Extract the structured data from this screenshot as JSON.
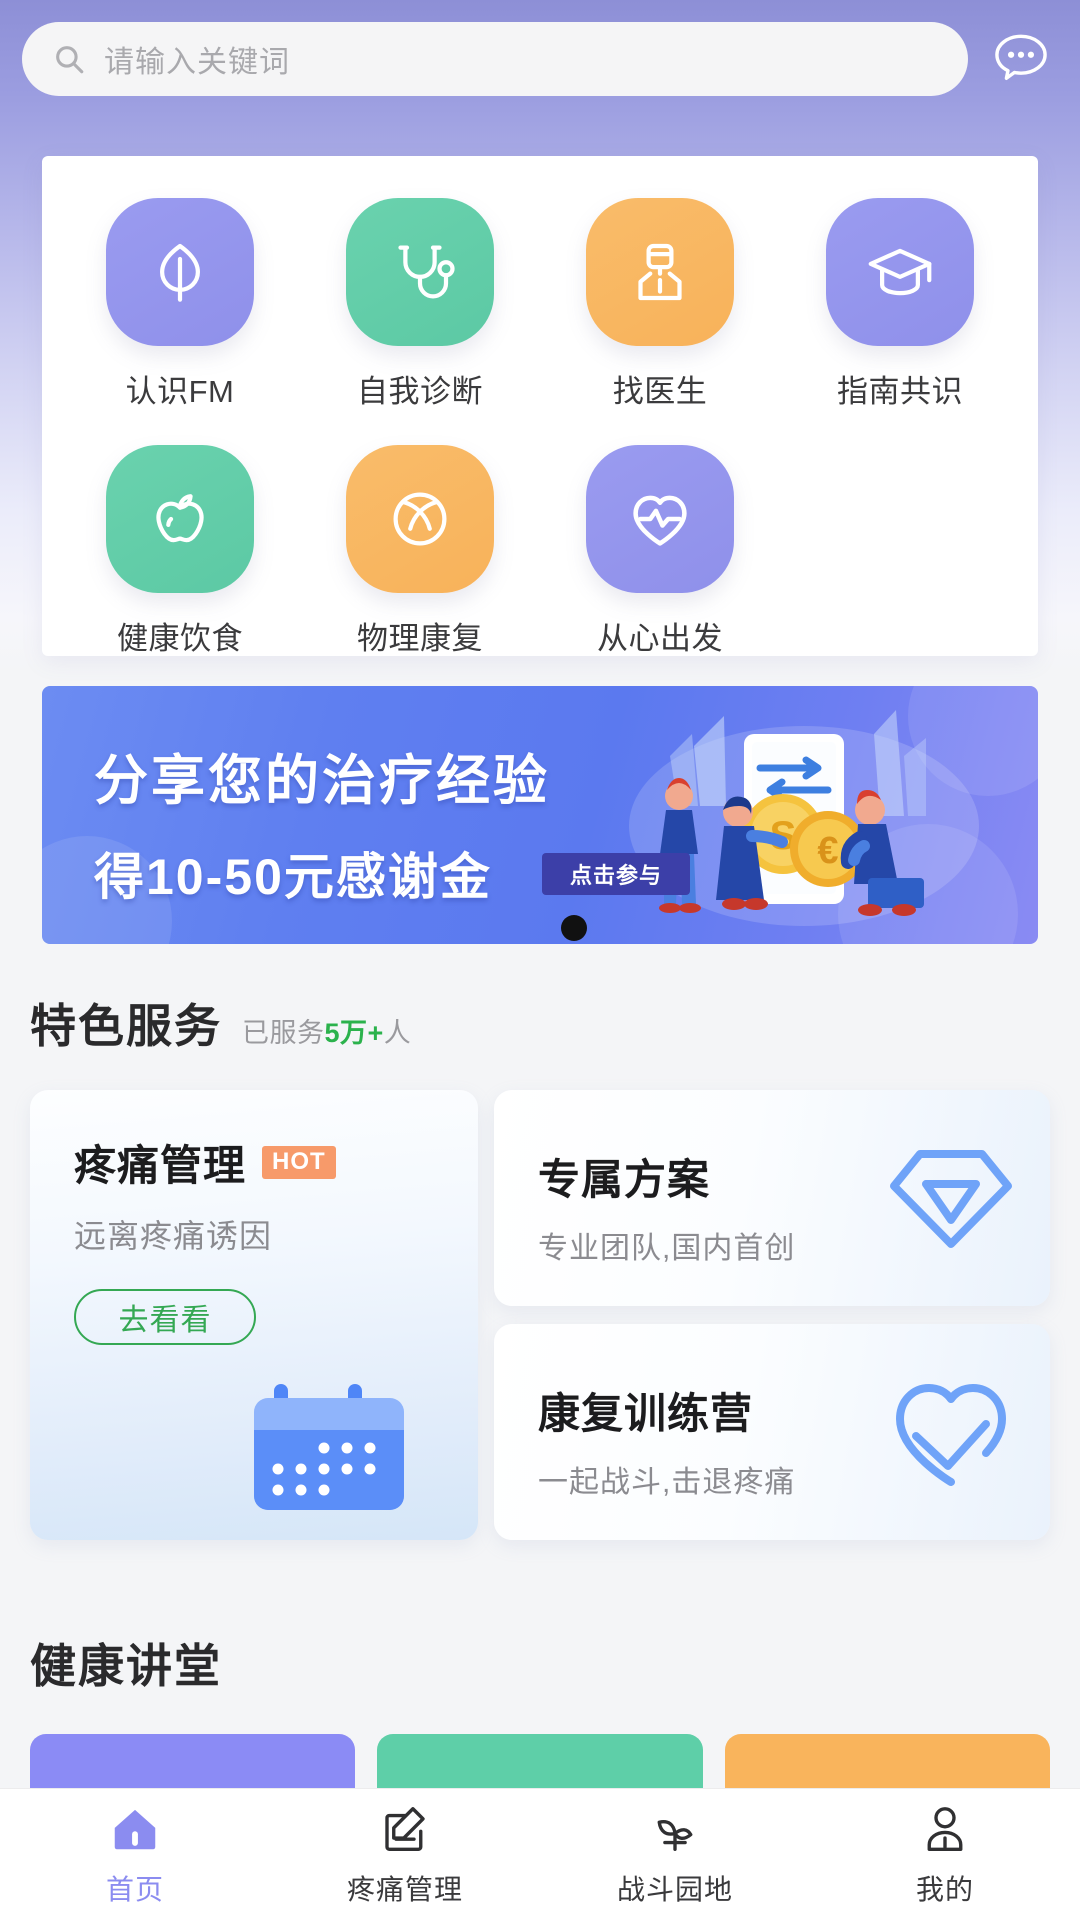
{
  "header": {
    "search": {
      "placeholder": "请输入关键词",
      "value": "",
      "icon": "search-icon"
    },
    "chat_icon": "chat-bubble-dots-icon",
    "gradient_from": "#8d8fd6",
    "gradient_to": "#f4f5f7"
  },
  "quick_grid": {
    "items": [
      {
        "label": "认识FM",
        "icon": "leaf-icon",
        "color": "#9a9bf0",
        "tone": "purple"
      },
      {
        "label": "自我诊断",
        "icon": "stethoscope-icon",
        "color": "#5cc9a4",
        "tone": "green"
      },
      {
        "label": "找医生",
        "icon": "doctor-icon",
        "color": "#f8b25a",
        "tone": "orange"
      },
      {
        "label": "指南共识",
        "icon": "graduation-cap-icon",
        "color": "#8f90ea",
        "tone": "purple"
      },
      {
        "label": "健康饮食",
        "icon": "apple-icon",
        "color": "#5cc9a4",
        "tone": "green"
      },
      {
        "label": "物理康复",
        "icon": "ball-icon",
        "color": "#f8b25a",
        "tone": "orange"
      },
      {
        "label": "从心出发",
        "icon": "heart-pulse-icon",
        "color": "#8f90ea",
        "tone": "purple"
      }
    ]
  },
  "banner": {
    "line1": "分享您的治疗经验",
    "line2": "得10-50元感谢金",
    "cta": "点击参与",
    "accent": "#5b79ef",
    "cta_bg": "#3c3fa8"
  },
  "featured": {
    "title": "特色服务",
    "subtitle_pre": "已服务",
    "subtitle_count": "5万+",
    "subtitle_post": "人",
    "count_color": "#2bb24c",
    "pain_card": {
      "title": "疼痛管理",
      "badge": "HOT",
      "badge_color": "#f79a6a",
      "subtitle": "远离疼痛诱因",
      "button": "去看看",
      "button_color": "#34a853",
      "icon": "calendar-icon"
    },
    "right_cards": [
      {
        "title": "专属方案",
        "subtitle": "专业团队,国内首创",
        "icon": "diamond-icon"
      },
      {
        "title": "康复训练营",
        "subtitle": "一起战斗,击退疼痛",
        "icon": "heart-check-icon"
      }
    ]
  },
  "lecture": {
    "title": "健康讲堂",
    "cards": [
      {
        "color": "#8b8bf5"
      },
      {
        "color": "#5ecfa8"
      },
      {
        "color": "#f9b45c"
      }
    ]
  },
  "tabbar": {
    "items": [
      {
        "label": "首页",
        "icon": "home-icon",
        "active": true
      },
      {
        "label": "疼痛管理",
        "icon": "edit-icon",
        "active": false
      },
      {
        "label": "战斗园地",
        "icon": "sprout-icon",
        "active": false
      },
      {
        "label": "我的",
        "icon": "person-icon",
        "active": false
      }
    ],
    "active_color": "#8b8cf0"
  }
}
